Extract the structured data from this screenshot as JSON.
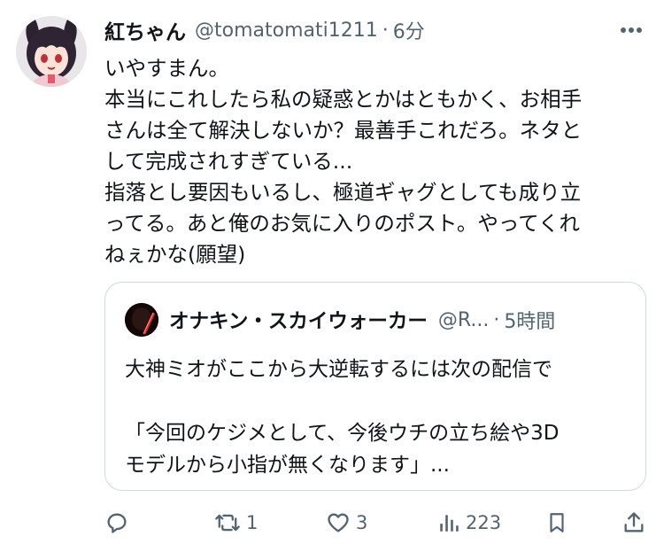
{
  "tweet": {
    "display_name": "紅ちゃん",
    "handle": "@tomatomati1211",
    "separator": "·",
    "time": "6分",
    "lines": [
      "いやすまん。",
      "本当にこれしたら私の疑惑とかはともかく、お相手",
      "さんは全て解決しないか？最善手これだろ。ネタと",
      "して完成されすぎている...",
      "指落とし要因もいるし、極道ギャグとしても成り立",
      "ってる。あと俺のお気に入りのポスト。やってくれ",
      "ねぇかな(願望)"
    ]
  },
  "quoted": {
    "display_name": "オナキン・スカイウォーカー",
    "handle": "@R...",
    "separator": "·",
    "time": "5時間",
    "lines": [
      "大神ミオがここから大逆転するには次の配信で",
      "",
      "「今回のケジメとして、今後ウチの立ち絵や3D",
      "モデルから小指が無くなります」..."
    ]
  },
  "actions": {
    "reply_icon": "reply-icon",
    "retweet_icon": "retweet-icon",
    "retweet_count": "1",
    "like_icon": "heart-icon",
    "like_count": "3",
    "views_icon": "views-icon",
    "views_count": "223",
    "bookmark_icon": "bookmark-icon",
    "share_icon": "share-icon"
  },
  "colors": {
    "text": "#0f1419",
    "secondary": "#536471",
    "border": "#cfd9de"
  }
}
